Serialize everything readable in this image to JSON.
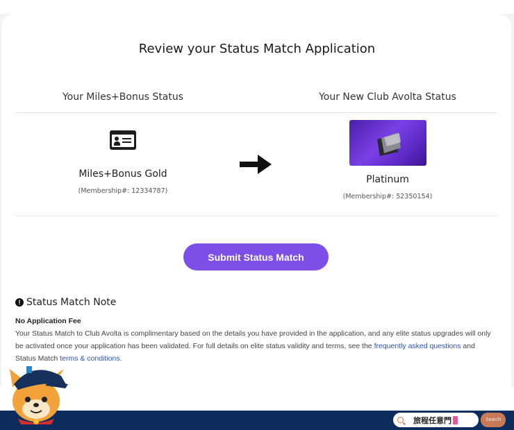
{
  "page": {
    "title": "Review your Status Match Application"
  },
  "current_status": {
    "heading": "Your Miles+Bonus Status",
    "icon": "id-card-icon",
    "tier": "Miles+Bonus Gold",
    "membership": "(Membership#: 12334787)"
  },
  "arrow_icon": "right-arrow-icon",
  "new_status": {
    "heading": "Your New Club Avolta Status",
    "tier": "Platinum",
    "membership": "(Membership#: 52350154)"
  },
  "submit_label": "Submit Status Match",
  "note": {
    "heading": "Status Match Note",
    "icon": "exclamation-circle-icon",
    "subheading": "No Application Fee",
    "body_part1": "Your Status Match to Club Avolta is complimentary based on the details you have provided in the application, and any elite status upgrades will only be activated once your application has been validated. For full details on elite status validity and terms, see the ",
    "faq_link": "frequently asked questions",
    "body_part2": " and Status Match ",
    "terms_link": "terms & conditions",
    "body_part3": "."
  },
  "footer": {
    "search_text": "旅程任意門",
    "search_button": "Search"
  },
  "colors": {
    "accent": "#7e4ee8",
    "link": "#2a52c8",
    "footer": "#0c2c5e"
  }
}
